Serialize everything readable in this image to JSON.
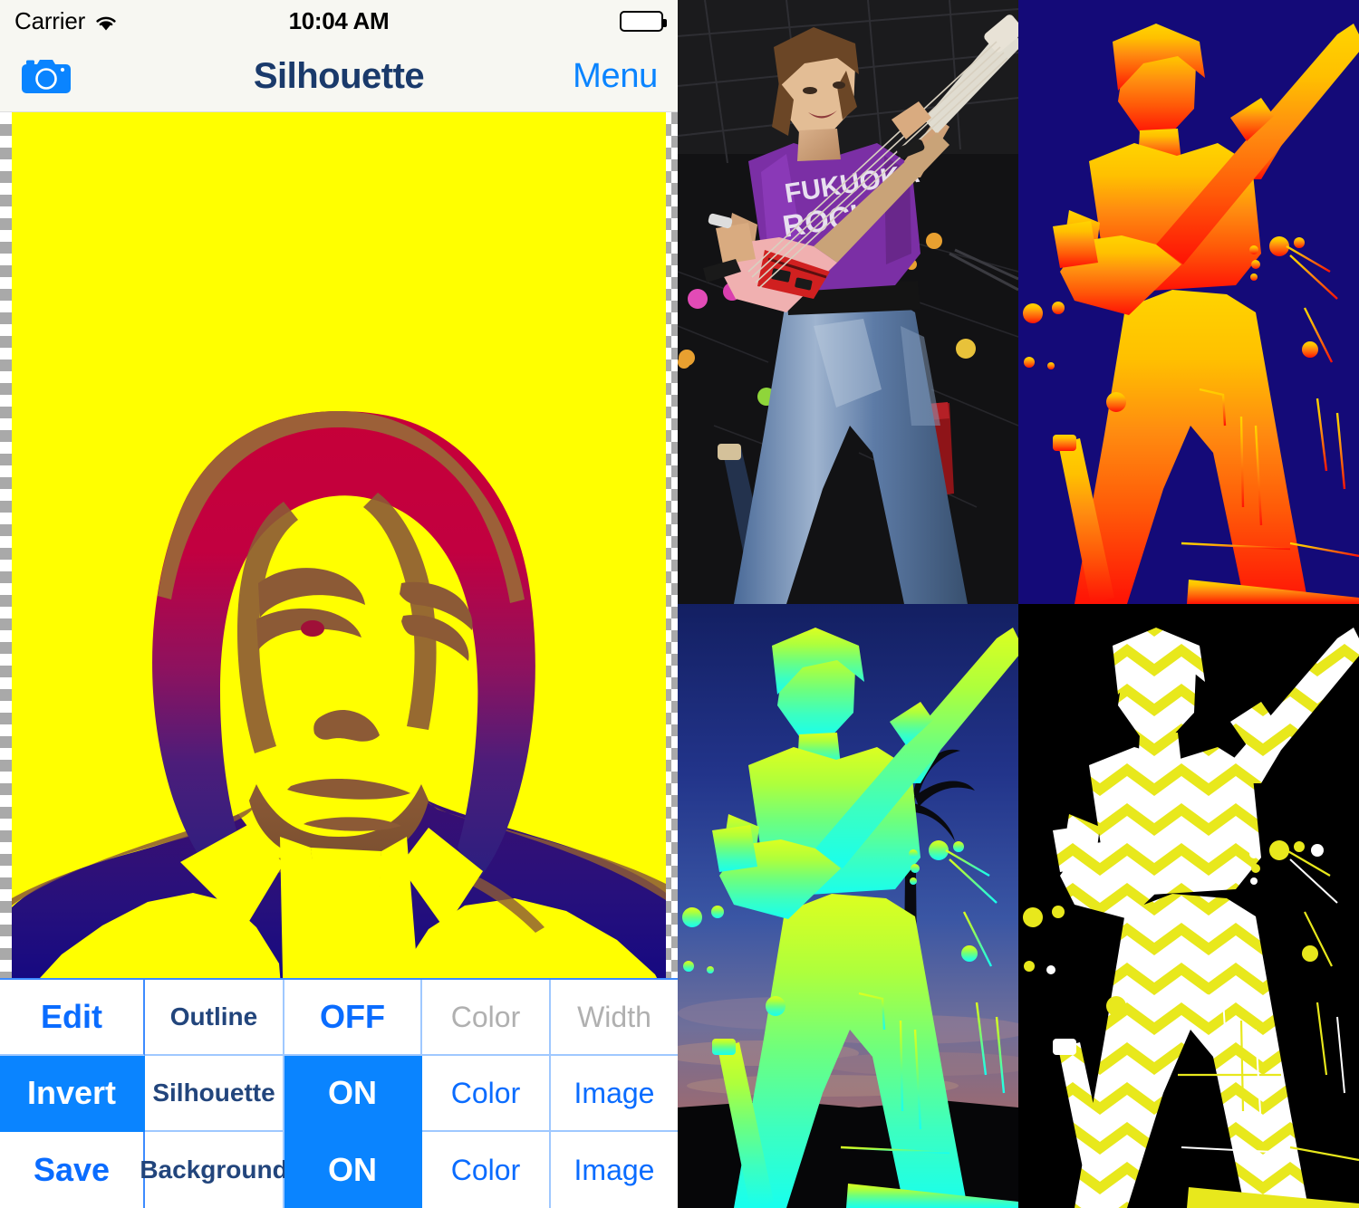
{
  "status_bar": {
    "carrier": "Carrier",
    "wifi_icon": "wifi-icon",
    "time": "10:04 AM",
    "battery_icon": "battery-full-icon"
  },
  "nav_bar": {
    "camera_icon": "camera-icon",
    "title": "Silhouette",
    "menu_label": "Menu"
  },
  "canvas": {
    "transparency_checker": "checkerboard-pattern",
    "background_color": "#ffff00",
    "subject_top_color": "#c8003c",
    "subject_mid_color": "#6b1070",
    "subject_bottom_color": "#100084",
    "outline_color": "#8c5a36"
  },
  "controls": {
    "rows": [
      {
        "action": "Edit",
        "label": "Outline",
        "toggle": "OFF",
        "toggle_state": "off",
        "option_a": "Color",
        "option_a_enabled": false,
        "option_b": "Width",
        "option_b_enabled": false
      },
      {
        "action": "Invert",
        "action_active": true,
        "label": "Silhouette",
        "toggle": "ON",
        "toggle_state": "on",
        "option_a": "Color",
        "option_a_enabled": true,
        "option_b": "Image",
        "option_b_enabled": true
      },
      {
        "action": "Save",
        "action_active": false,
        "label": "Background",
        "toggle": "ON",
        "toggle_state": "on",
        "option_a": "Color",
        "option_a_enabled": true,
        "option_b": "Image",
        "option_b_enabled": true
      }
    ],
    "accent_color": "#0a84ff",
    "label_color": "#22457c",
    "disabled_color": "#b0b0b0",
    "grid_line_color": "#9fc8ff"
  },
  "gallery": {
    "tiles": [
      {
        "name": "original-photo",
        "caption": "Bass player on stage, purple FUKUOKA ROCK t-shirt, blue jeans, pink bass guitar",
        "shirt_color": "#7b2fa5",
        "shirt_text_line1": "FUKUOKA",
        "shirt_text_line2": "ROCK",
        "jeans_color": "#5878a8",
        "guitar_body_color": "#f0a8a8",
        "guitar_pickguard_color": "#d02020",
        "background_color": "#1a1a1a"
      },
      {
        "name": "silhouette-orange-on-navy",
        "caption": "Silhouette filled with yellow-orange-red vertical gradient on dark navy background",
        "background_color": "#140a78",
        "fill_top": "#ffd000",
        "fill_mid": "#ff7800",
        "fill_bottom": "#ff1000"
      },
      {
        "name": "silhouette-green-on-sunset",
        "caption": "Silhouette filled with green-to-cyan gradient over a twilight sunset sky with palm tree",
        "sky_top": "#1a2a7a",
        "sky_mid": "#3050a0",
        "sky_cloud": "#a87878",
        "ground_color": "#060608",
        "fill_top": "#d8ff2a",
        "fill_mid": "#6dff8c",
        "fill_bottom": "#20ffe0"
      },
      {
        "name": "silhouette-chevron-on-black",
        "caption": "Silhouette filled with yellow and white zigzag chevron stripes on black background",
        "background_color": "#000000",
        "stripe_a": "#e8e81c",
        "stripe_b": "#ffffff"
      }
    ]
  }
}
